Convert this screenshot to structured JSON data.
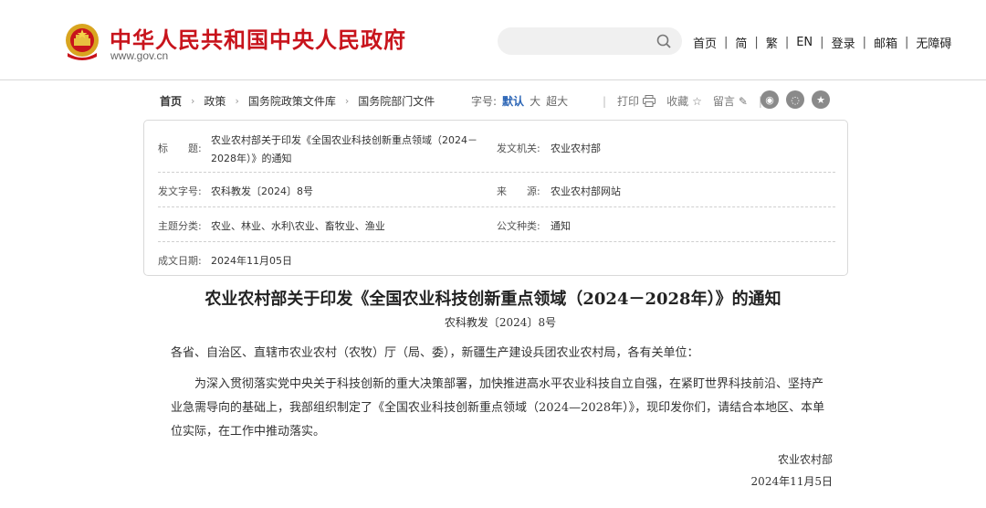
{
  "header": {
    "site_title": "中华人民共和国中央人民政府",
    "site_url": "www.gov.cn",
    "search_placeholder": "",
    "nav": [
      "首页",
      "简",
      "繁",
      "EN",
      "登录",
      "邮箱",
      "无障碍"
    ]
  },
  "crumbs": [
    "首页",
    "政策",
    "国务院政策文件库",
    "国务院部门文件"
  ],
  "fontsize": {
    "label": "字号:",
    "options": [
      "默认",
      "大",
      "超大"
    ]
  },
  "tools": {
    "print": "打印",
    "collect": "收藏",
    "comment": "留言"
  },
  "social": [
    "weibo-icon",
    "wechat-icon",
    "star-icon"
  ],
  "info": {
    "title_label": "标　　题:",
    "title_value_line1": "农业农村部关于印发《全国农业科技创新重点领域（2024－",
    "title_value_line2": "2028年）》的通知",
    "issuer_label": "发文机关:",
    "issuer_value": "农业农村部",
    "docno_label": "发文字号:",
    "docno_value": "农科教发〔2024〕8号",
    "source_label": "来　　源:",
    "source_value": "农业农村部网站",
    "topic_label": "主题分类:",
    "topic_value": "农业、林业、水利\\农业、畜牧业、渔业",
    "type_label": "公文种类:",
    "type_value": "通知",
    "date_label": "成文日期:",
    "date_value": "2024年11月05日"
  },
  "article": {
    "title": "农业农村部关于印发《全国农业科技创新重点领域（2024－2028年）》的通知",
    "docno": "农科教发〔2024〕8号",
    "salutation": "各省、自治区、直辖市农业农村（农牧）厅（局、委），新疆生产建设兵团农业农村局，各有关单位：",
    "body": "为深入贯彻落实党中央关于科技创新的重大决策部署，加快推进高水平农业科技自立自强，在紧盯世界科技前沿、坚持产业急需导向的基础上，我部组织制定了《全国农业科技创新重点领域（2024—2028年）》，现印发你们，请结合本地区、本单位实际，在工作中推动落实。",
    "signer": "农业农村部",
    "sign_date": "2024年11月5日"
  },
  "colors": {
    "brand_red": "#c8141c",
    "accent_blue": "#2a64b5"
  }
}
